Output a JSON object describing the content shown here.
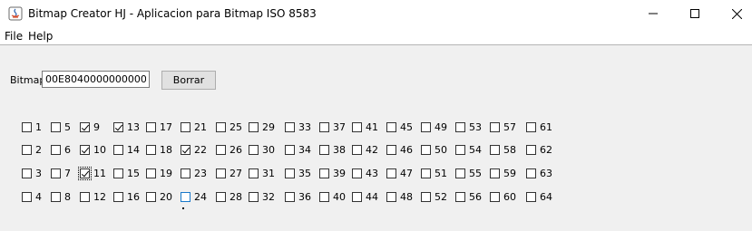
{
  "window": {
    "title": "Bitmap Creator HJ - Aplicacion para Bitmap ISO 8583"
  },
  "menu": {
    "items": [
      "File",
      "Help"
    ]
  },
  "bitmap": {
    "label": "Bitmap",
    "value": "00E8040000000000",
    "clear_button": "Borrar"
  },
  "fields": [
    {
      "label": "1",
      "checked": false
    },
    {
      "label": "2",
      "checked": false
    },
    {
      "label": "3",
      "checked": false
    },
    {
      "label": "4",
      "checked": false
    },
    {
      "label": "5",
      "checked": false
    },
    {
      "label": "6",
      "checked": false
    },
    {
      "label": "7",
      "checked": false
    },
    {
      "label": "8",
      "checked": false
    },
    {
      "label": "9",
      "checked": true
    },
    {
      "label": "10",
      "checked": true
    },
    {
      "label": "11",
      "checked": true,
      "focused": true
    },
    {
      "label": "12",
      "checked": false
    },
    {
      "label": "13",
      "checked": true
    },
    {
      "label": "14",
      "checked": false
    },
    {
      "label": "15",
      "checked": false
    },
    {
      "label": "16",
      "checked": false
    },
    {
      "label": "17",
      "checked": false
    },
    {
      "label": "18",
      "checked": false
    },
    {
      "label": "19",
      "checked": false
    },
    {
      "label": "20",
      "checked": false
    },
    {
      "label": "21",
      "checked": false
    },
    {
      "label": "22",
      "checked": true
    },
    {
      "label": "23",
      "checked": false
    },
    {
      "label": "24",
      "checked": false,
      "hover": true
    },
    {
      "label": "25",
      "checked": false
    },
    {
      "label": "26",
      "checked": false
    },
    {
      "label": "27",
      "checked": false
    },
    {
      "label": "28",
      "checked": false
    },
    {
      "label": "29",
      "checked": false
    },
    {
      "label": "30",
      "checked": false
    },
    {
      "label": "31",
      "checked": false
    },
    {
      "label": "32",
      "checked": false
    },
    {
      "label": "33",
      "checked": false
    },
    {
      "label": "34",
      "checked": false
    },
    {
      "label": "35",
      "checked": false
    },
    {
      "label": "36",
      "checked": false
    },
    {
      "label": "37",
      "checked": false
    },
    {
      "label": "38",
      "checked": false
    },
    {
      "label": "39",
      "checked": false
    },
    {
      "label": "40",
      "checked": false
    },
    {
      "label": "41",
      "checked": false
    },
    {
      "label": "42",
      "checked": false
    },
    {
      "label": "43",
      "checked": false
    },
    {
      "label": "44",
      "checked": false
    },
    {
      "label": "45",
      "checked": false
    },
    {
      "label": "46",
      "checked": false
    },
    {
      "label": "47",
      "checked": false
    },
    {
      "label": "48",
      "checked": false
    },
    {
      "label": "49",
      "checked": false
    },
    {
      "label": "50",
      "checked": false
    },
    {
      "label": "51",
      "checked": false
    },
    {
      "label": "52",
      "checked": false
    },
    {
      "label": "53",
      "checked": false
    },
    {
      "label": "54",
      "checked": false
    },
    {
      "label": "55",
      "checked": false
    },
    {
      "label": "56",
      "checked": false
    },
    {
      "label": "57",
      "checked": false
    },
    {
      "label": "58",
      "checked": false
    },
    {
      "label": "59",
      "checked": false
    },
    {
      "label": "60",
      "checked": false
    },
    {
      "label": "61",
      "checked": false
    },
    {
      "label": "62",
      "checked": false
    },
    {
      "label": "63",
      "checked": false
    },
    {
      "label": "64",
      "checked": false
    }
  ],
  "colors": {
    "background": "#f0f0f0",
    "hover_border": "#1979ca"
  }
}
